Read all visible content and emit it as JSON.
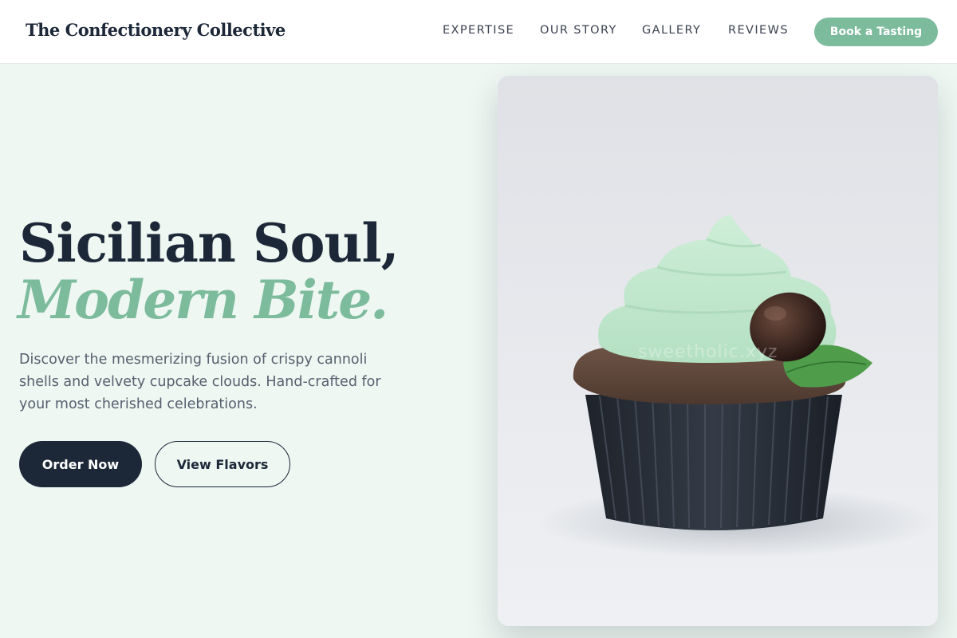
{
  "header": {
    "brand": "The Confectionery Collective",
    "nav": [
      "EXPERTISE",
      "OUR STORY",
      "GALLERY",
      "REVIEWS"
    ],
    "cta": "Book a Tasting"
  },
  "hero": {
    "headline": "Sicilian Soul,",
    "headline_accent": "Modern Bite.",
    "subtext": "Discover the mesmerizing fusion of crispy cannoli shells and velvety cupcake clouds. Hand-crafted for your most cherished celebrations.",
    "primary_button": "Order Now",
    "secondary_button": "View Flavors"
  },
  "image": {
    "subject": "cupcake-with-mint-frosting",
    "watermark": "sweetholic.xyz"
  },
  "colors": {
    "accent": "#7dbb9d",
    "dark": "#1c2738",
    "hero_background": "#eef7f2",
    "body_text": "#56606e"
  }
}
